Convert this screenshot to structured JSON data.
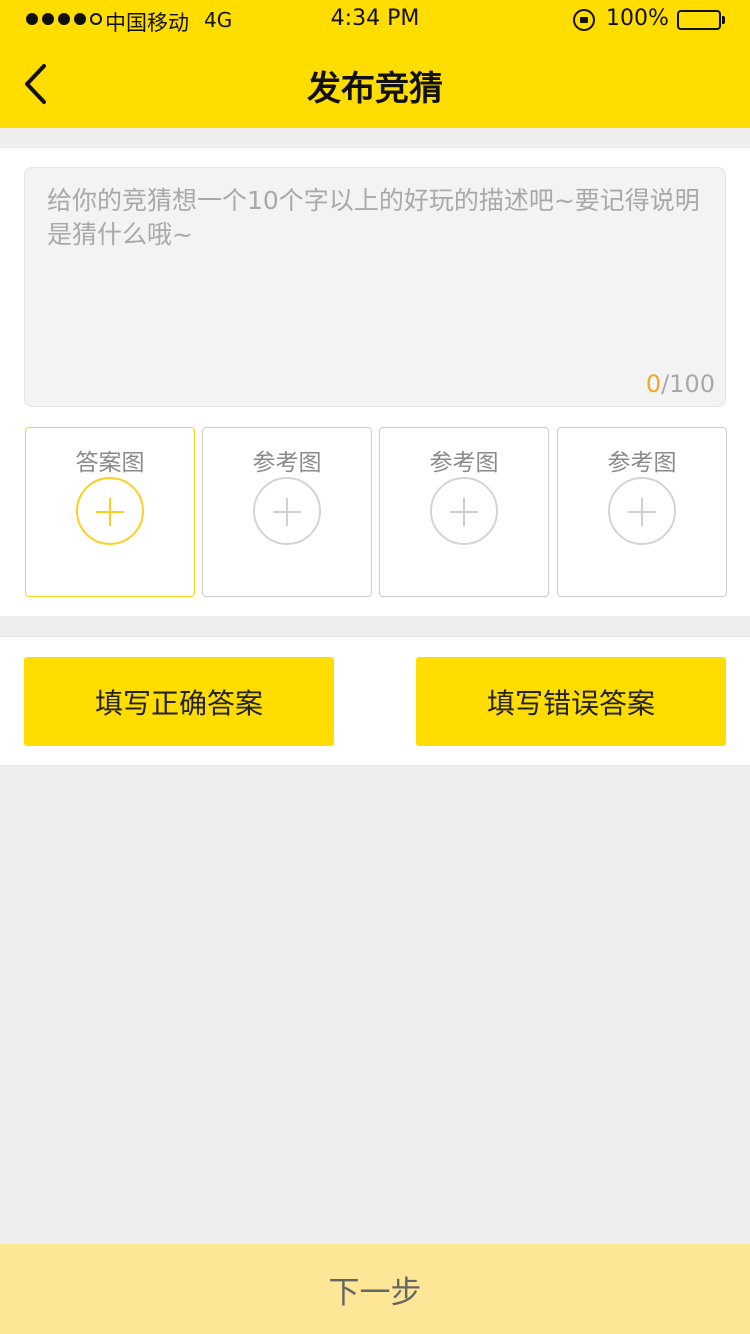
{
  "status_bar": {
    "carrier": "中国移动",
    "network": "4G",
    "time": "4:34 PM",
    "battery": "100%",
    "signal_bars": 4,
    "signal_max": 5
  },
  "nav": {
    "title": "发布竞猜",
    "back_icon": "chevron-left-icon"
  },
  "description": {
    "placeholder": "给你的竞猜想一个10个字以上的好玩的描述吧~要记得说明是猜什么哦~",
    "value": "",
    "count": "0",
    "max": "/100"
  },
  "image_slots": [
    {
      "label": "答案图",
      "icon": "add-circle-icon"
    },
    {
      "label": "参考图",
      "icon": "add-circle-icon"
    },
    {
      "label": "参考图",
      "icon": "add-circle-icon"
    },
    {
      "label": "参考图",
      "icon": "add-circle-icon"
    }
  ],
  "answers": {
    "correct_label": "填写正确答案",
    "wrong_label": "填写错误答案"
  },
  "footer": {
    "next_label": "下一步"
  },
  "colors": {
    "accent": "#ffdd00",
    "accent_light": "#fde796",
    "counter_highlight": "#f5a623",
    "background": "#eeeeee"
  }
}
